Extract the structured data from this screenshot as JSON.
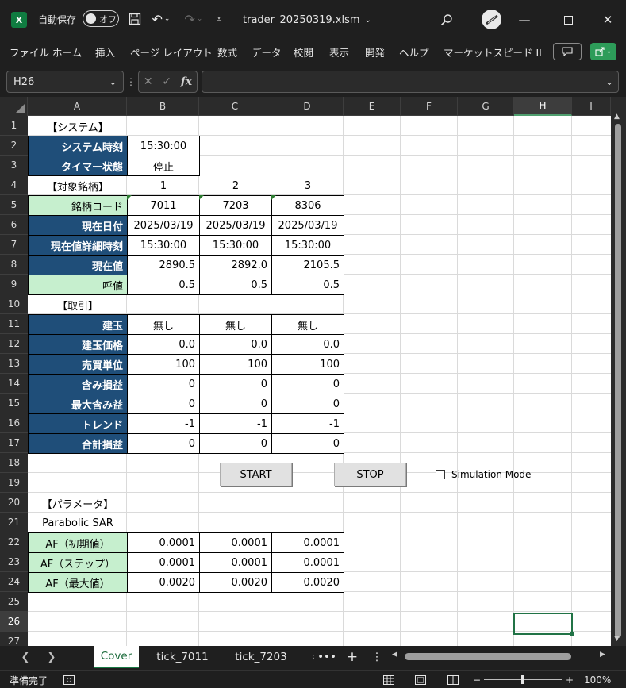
{
  "titlebar": {
    "app_icon": "excel-icon",
    "autosave_label": "自動保存",
    "autosave_state": "オフ",
    "file_title": "trader_20250319.xlsm",
    "avatar_label": "user"
  },
  "ribbon": {
    "tabs": [
      "ファイル",
      "ホーム",
      "挿入",
      "ページ レイアウト",
      "数式",
      "データ",
      "校閲",
      "表示",
      "開発",
      "ヘルプ",
      "マーケットスピード II"
    ]
  },
  "formula_bar": {
    "name_box": "H26",
    "fx": "fx",
    "formula": ""
  },
  "columns": [
    "A",
    "B",
    "C",
    "D",
    "E",
    "F",
    "G",
    "H",
    "I"
  ],
  "selected_column": "H",
  "selected_row": "26",
  "rows": [
    "1",
    "2",
    "3",
    "4",
    "5",
    "6",
    "7",
    "8",
    "9",
    "10",
    "11",
    "12",
    "13",
    "14",
    "15",
    "16",
    "17",
    "18",
    "19",
    "20",
    "21",
    "22",
    "23",
    "24",
    "25",
    "26",
    "27"
  ],
  "sheet": {
    "system_header": "【システム】",
    "system_time_label": "システム時刻",
    "system_time_value": "15:30:00",
    "timer_label": "タイマー状態",
    "timer_value": "停止",
    "target_header": "【対象銘柄】",
    "target_nums": [
      "1",
      "2",
      "3"
    ],
    "code_label": "銘柄コード",
    "codes": [
      "7011",
      "7203",
      "8306"
    ],
    "date_label": "現在日付",
    "dates": [
      "2025/03/19",
      "2025/03/19",
      "2025/03/19"
    ],
    "detail_time_label": "現在値詳細時刻",
    "detail_times": [
      "15:30:00",
      "15:30:00",
      "15:30:00"
    ],
    "price_label": "現在値",
    "prices": [
      "2890.5",
      "2892.0",
      "2105.5"
    ],
    "tick_label": "呼値",
    "ticks": [
      "0.5",
      "0.5",
      "0.5"
    ],
    "trade_header": "【取引】",
    "position_label": "建玉",
    "positions": [
      "無し",
      "無し",
      "無し"
    ],
    "position_price_label": "建玉価格",
    "position_prices": [
      "0.0",
      "0.0",
      "0.0"
    ],
    "unit_label": "売買単位",
    "units": [
      "100",
      "100",
      "100"
    ],
    "unrealized_label": "含み損益",
    "unrealized": [
      "0",
      "0",
      "0"
    ],
    "max_unrealized_label": "最大含み益",
    "max_unrealized": [
      "0",
      "0",
      "0"
    ],
    "trend_label": "トレンド",
    "trends": [
      "-1",
      "-1",
      "-1"
    ],
    "total_label": "合計損益",
    "totals": [
      "0",
      "0",
      "0"
    ],
    "start_button": "START",
    "stop_button": "STOP",
    "simulation_label": "Simulation Mode",
    "param_header": "【パラメータ】",
    "psar_label": "Parabolic SAR",
    "af_init_label": "AF（初期値）",
    "af_init": [
      "0.0001",
      "0.0001",
      "0.0001"
    ],
    "af_step_label": "AF（ステップ）",
    "af_step": [
      "0.0001",
      "0.0001",
      "0.0001"
    ],
    "af_max_label": "AF（最大値）",
    "af_max": [
      "0.0020",
      "0.0020",
      "0.0020"
    ]
  },
  "sheet_tabs": [
    "Cover",
    "tick_7011",
    "tick_7203"
  ],
  "status": {
    "ready": "準備完了",
    "zoom": "100%"
  },
  "colors": {
    "header_navy": "#1f4e79",
    "label_green": "#c6efce",
    "excel_green": "#217346"
  }
}
